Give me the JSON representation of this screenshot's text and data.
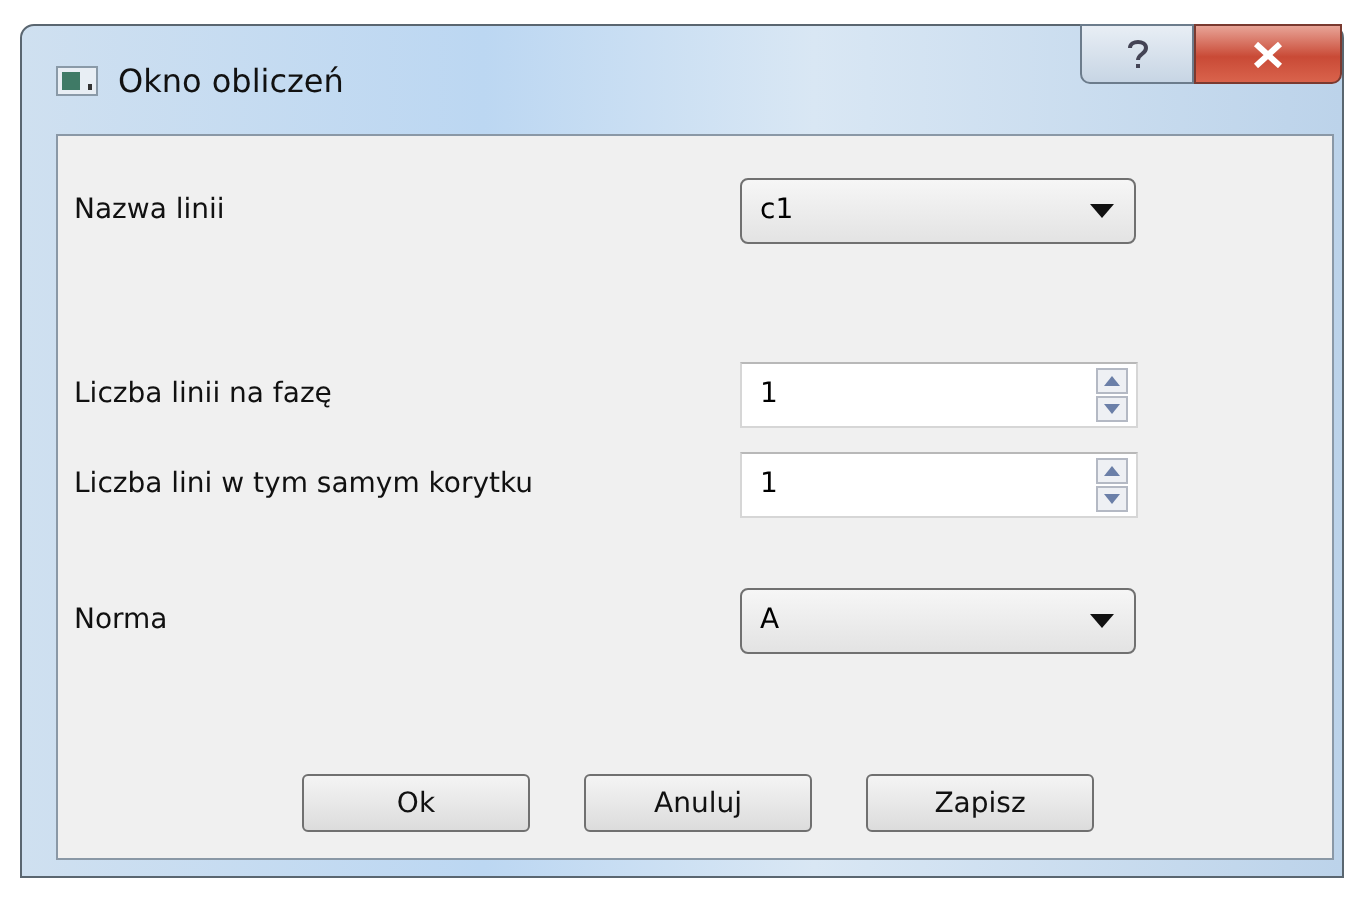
{
  "window": {
    "title": "Okno obliczeń"
  },
  "fields": [
    {
      "kind": "combo",
      "label": "Nazwa linii",
      "value": "c1"
    },
    {
      "kind": "spin",
      "label": "Liczba linii na fazę",
      "value": "1"
    },
    {
      "kind": "spin",
      "label": "Liczba lini w tym samym korytku",
      "value": "1"
    },
    {
      "kind": "combo",
      "label": "Norma",
      "value": "A"
    }
  ],
  "buttons": [
    "Ok",
    "Anuluj",
    "Zapisz"
  ]
}
